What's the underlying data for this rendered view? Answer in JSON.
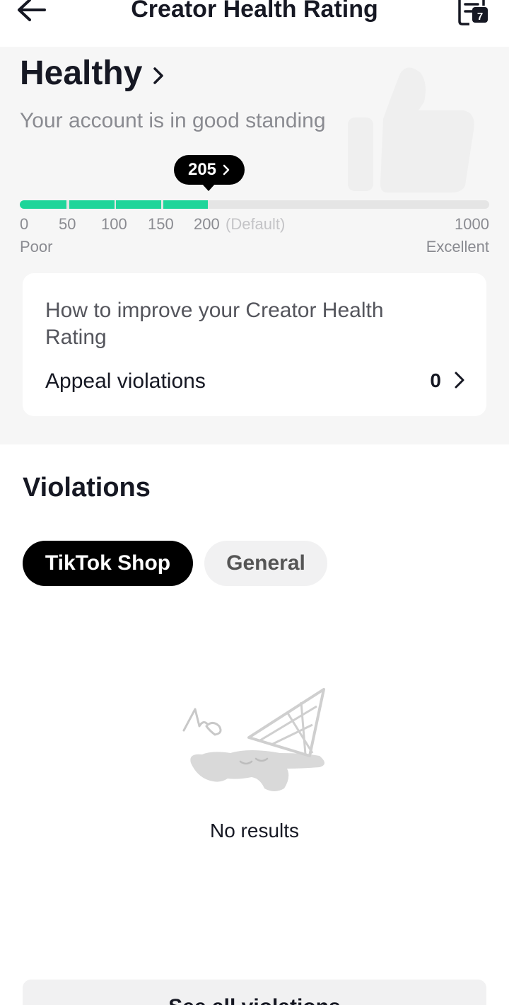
{
  "header": {
    "title": "Creator Health Rating",
    "back_icon": "arrow-left-icon",
    "doc_icon": "document-calendar-icon",
    "doc_badge": "7"
  },
  "rating": {
    "status": "Healthy",
    "subtitle": "Your account is in good standing",
    "score": "205",
    "score_value": 205,
    "scale": {
      "min": 0,
      "max": 1000,
      "ticks": [
        "0",
        "50",
        "100",
        "150",
        "200"
      ],
      "default_note": "(Default)",
      "max_label": "1000",
      "low_label": "Poor",
      "high_label": "Excellent"
    },
    "accent_color": "#1ed59a"
  },
  "improve": {
    "title": "How to improve your Creator Health Rating",
    "appeal_label": "Appeal violations",
    "appeal_count": "0"
  },
  "violations": {
    "title": "Violations",
    "tabs": [
      {
        "label": "TikTok Shop",
        "active": true
      },
      {
        "label": "General",
        "active": false
      }
    ],
    "empty_text": "No results"
  },
  "bottom": {
    "button_label": "See all violations"
  }
}
